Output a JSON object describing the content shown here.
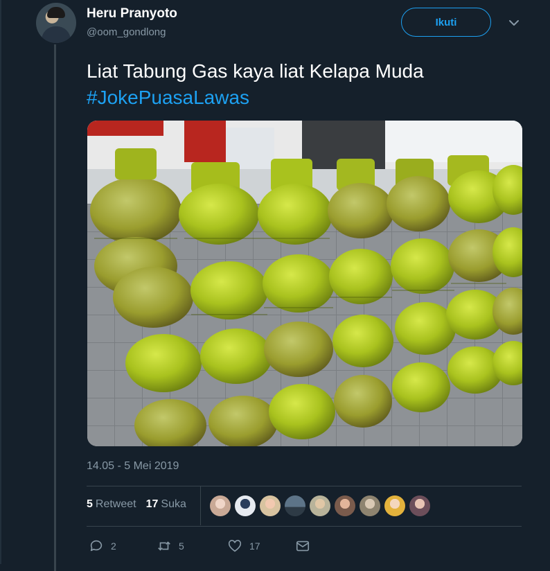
{
  "author": {
    "name": "Heru Pranyoto",
    "handle": "@oom_gondlong"
  },
  "follow_button": {
    "label": "Ikuti"
  },
  "tweet": {
    "text_line1": "Liat Tabung Gas kaya liat Kelapa Muda",
    "hashtag": "#JokePuasaLawas",
    "timestamp": "14.05 - 5 Mei 2019"
  },
  "stats": {
    "retweet_count": "5",
    "retweet_label": "Retweet",
    "like_count": "17",
    "like_label": "Suka"
  },
  "actions": {
    "reply_count": "2",
    "retweet_count": "5",
    "like_count": "17"
  },
  "colors": {
    "background": "#15202b",
    "accent": "#1da1f2",
    "muted": "#8899a6",
    "divider": "#38444d"
  },
  "icons": {
    "caret": "chevron-down-icon",
    "reply": "reply-icon",
    "retweet": "retweet-icon",
    "like": "heart-icon",
    "message": "envelope-icon"
  }
}
